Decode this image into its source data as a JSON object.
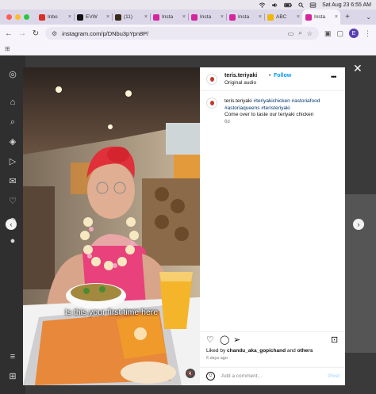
{
  "menubar": {
    "date_time": "Sat Aug 23  6:55 AM"
  },
  "tabs": [
    {
      "label": "Inbo",
      "favicon_color": "#d93025",
      "favicon_icon": "gmail-icon"
    },
    {
      "label": "EVW",
      "favicon_color": "#111111",
      "favicon_icon": "x-logo-icon"
    },
    {
      "label": "(11)",
      "favicon_color": "#3a2a1a",
      "favicon_icon": "site-icon"
    },
    {
      "label": "Insta",
      "favicon_color": "#d6249f",
      "favicon_icon": "instagram-icon"
    },
    {
      "label": "Insta",
      "favicon_color": "#d6249f",
      "favicon_icon": "instagram-icon"
    },
    {
      "label": "Insta",
      "favicon_color": "#d6249f",
      "favicon_icon": "instagram-icon"
    },
    {
      "label": "ABC",
      "favicon_color": "#f2b705",
      "favicon_icon": "site-icon"
    },
    {
      "label": "Insta",
      "favicon_color": "#d6249f",
      "favicon_icon": "instagram-icon",
      "active": true
    }
  ],
  "toolbar": {
    "url": "instagram.com/p/DNbu3pYpn8P/",
    "profile_initial": "E"
  },
  "post": {
    "username": "teris.teriyaki",
    "follow_label": "Follow",
    "separator": "•",
    "audio": "Original audio",
    "caption_username": "teris.teriyaki",
    "hashtags": "#teriyakichicken #astoriafood #astoriaqueens #teristeriyaki",
    "caption_text": "Come over to taste our teriyaki chicken",
    "comment_age": "6d",
    "liked_by_prefix": "Liked by",
    "liked_by_user": "chandu_aka_gopichand",
    "liked_by_and": "and",
    "liked_by_others": "others",
    "posted_ago": "6 days ago",
    "comment_placeholder": "Add a comment…",
    "post_label": "Post"
  },
  "video": {
    "subtitle": "Is this your first time here"
  },
  "colors": {
    "accent": "#0095f6",
    "post_disabled": "#b3dbff"
  }
}
